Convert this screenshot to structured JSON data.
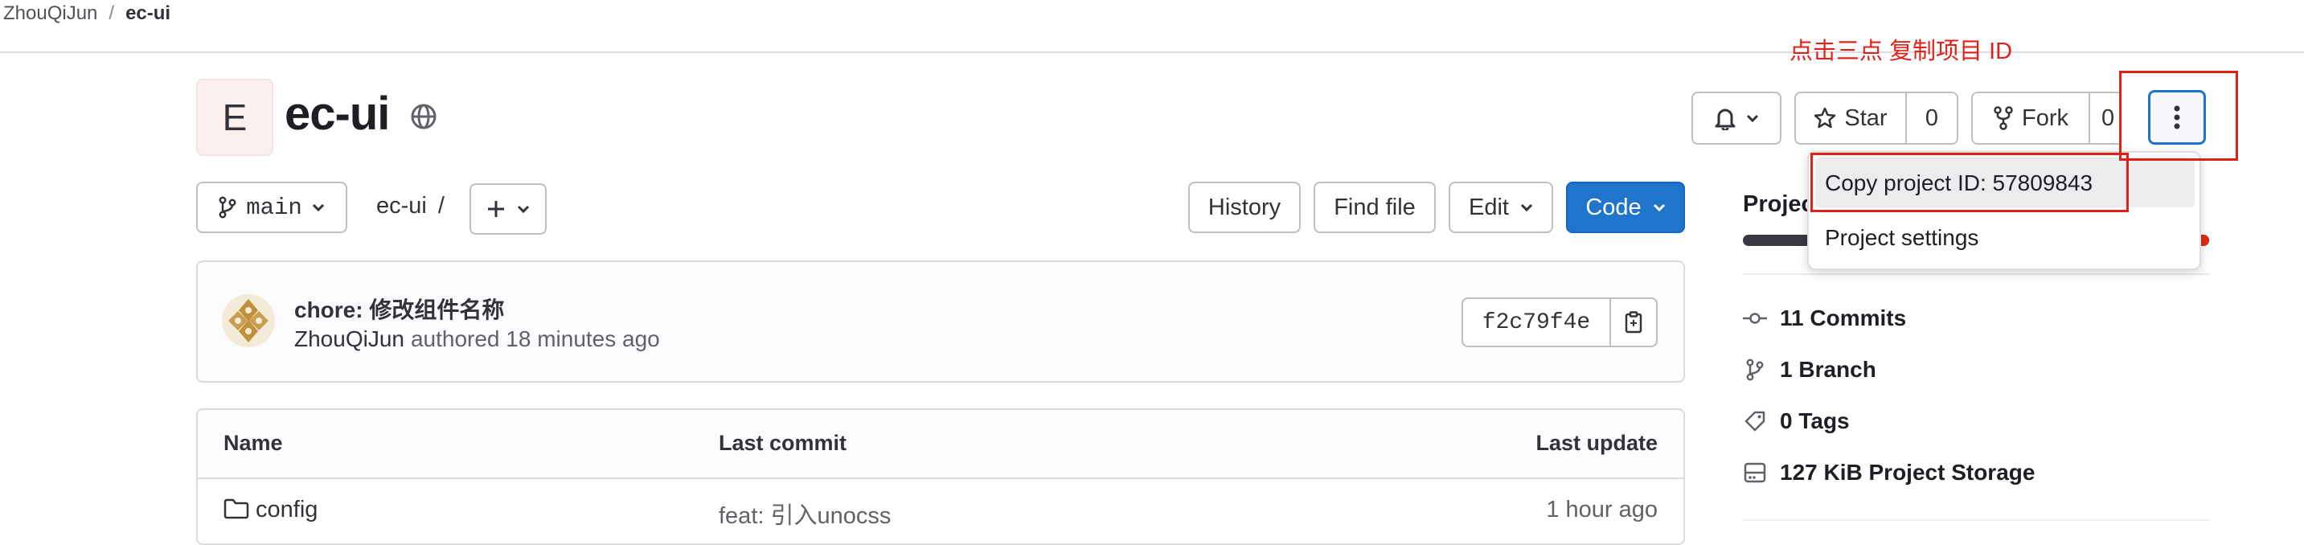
{
  "breadcrumb": {
    "namespace": "ZhouQiJun",
    "separator": "/",
    "project": "ec-ui"
  },
  "annotation": {
    "text": "点击三点 复制项目 ID",
    "color": "#e0221b"
  },
  "project": {
    "avatar_letter": "E",
    "name": "ec-ui"
  },
  "actions": {
    "star_label": "Star",
    "star_count": "0",
    "fork_label": "Fork",
    "fork_count": "0"
  },
  "dropdown": {
    "copy_id_label": "Copy project ID: 57809843",
    "settings_label": "Project settings"
  },
  "toolbar": {
    "branch": "main",
    "path": "ec-ui",
    "path_sep": "/",
    "history": "History",
    "find_file": "Find file",
    "edit": "Edit",
    "code": "Code"
  },
  "commit": {
    "title": "chore: 修改组件名称",
    "author": "ZhouQiJun",
    "authored": "authored 18 minutes ago",
    "sha": "f2c79f4e"
  },
  "table": {
    "headers": {
      "name": "Name",
      "last_commit": "Last commit",
      "last_update": "Last update"
    },
    "rows": [
      {
        "name": "config",
        "commit": "feat: 引入unocss",
        "updated": "1 hour ago"
      }
    ]
  },
  "sidebar": {
    "heading": "Project information",
    "commits": "11 Commits",
    "branches": "1 Branch",
    "tags": "0 Tags",
    "storage": "127 KiB Project Storage"
  },
  "colors": {
    "primary": "#1f75cb",
    "highlight_red": "#e0221b"
  }
}
